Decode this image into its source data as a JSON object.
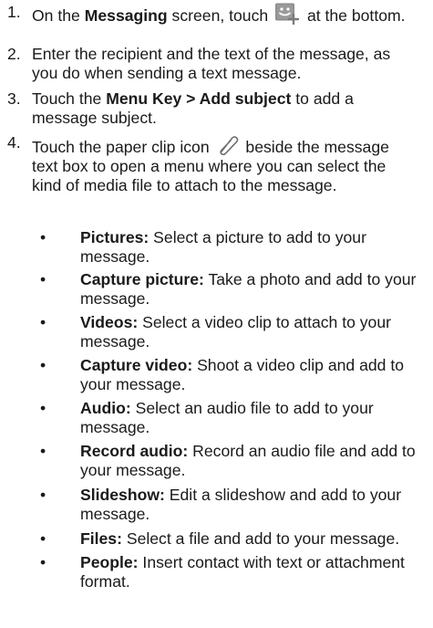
{
  "steps": [
    {
      "number": "1.",
      "t1": "On the ",
      "b1": "Messaging",
      "t2": " screen, touch ",
      "icon": "new-message-icon",
      "t3": " at the bottom."
    },
    {
      "number": "2.",
      "t1": "Enter the recipient and the text of the message, as you do when sending a text message."
    },
    {
      "number": "3.",
      "t1": "Touch the ",
      "b1": "Menu Key > Add subject",
      "t2": " to add a message subject."
    },
    {
      "number": "4.",
      "t1": "Touch the paper clip icon ",
      "icon": "paper-clip-icon",
      "t2": " beside the message text box to open a menu where you can select the kind of media file to attach to the message."
    }
  ],
  "bullet_char": "•",
  "options": [
    {
      "name": "Pictures:",
      "desc": " Select a picture to add to your message."
    },
    {
      "name": "Capture picture:",
      "desc": " Take a photo and add to your message."
    },
    {
      "name": "Videos:",
      "desc": " Select a video clip to attach to your message."
    },
    {
      "name": "Capture video:",
      "desc": " Shoot a video clip and add to your message."
    },
    {
      "name": "Audio:",
      "desc": " Select an audio file to add to your message."
    },
    {
      "name": "Record audio:",
      "desc": " Record an audio file and add to your message."
    },
    {
      "name": "Slideshow:",
      "desc": " Edit a slideshow and add to your message."
    },
    {
      "name": "Files:",
      "desc": " Select a file and add to your message."
    },
    {
      "name": "People:",
      "desc": " Insert contact with text or attachment format."
    }
  ],
  "colors": {
    "text": "#1a1a1a",
    "icon_bg": "#8a8a8a"
  }
}
